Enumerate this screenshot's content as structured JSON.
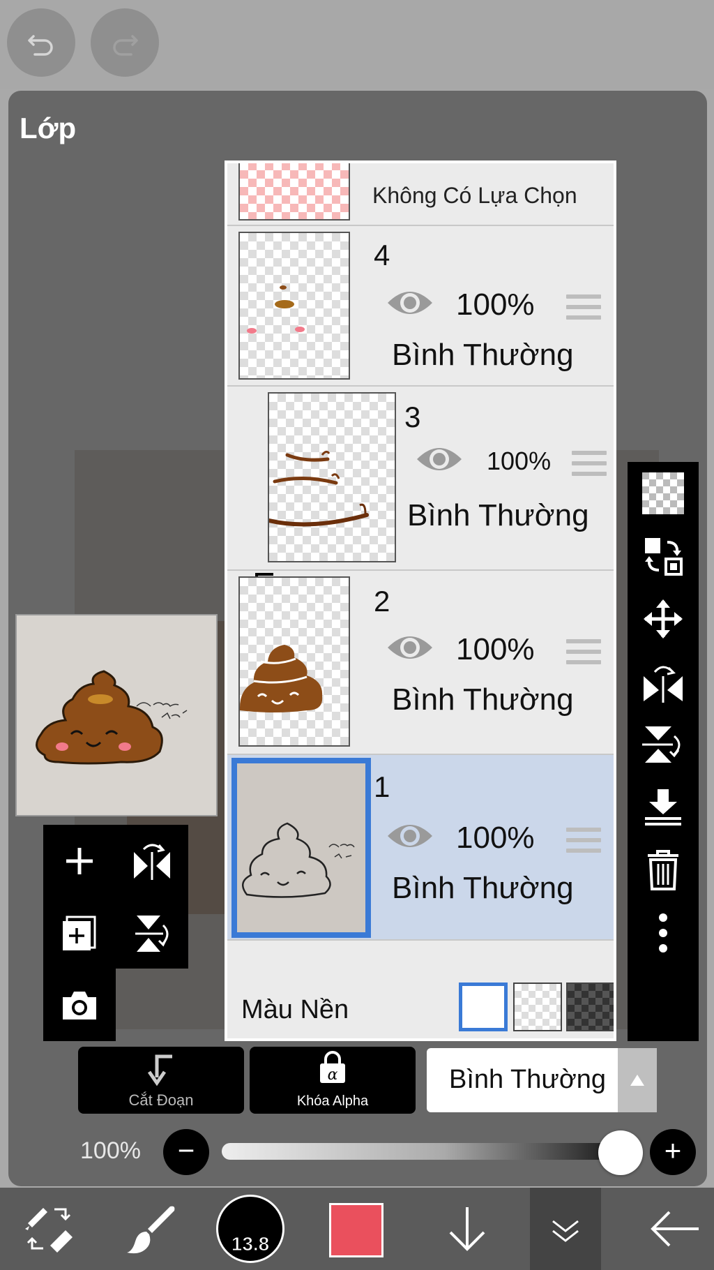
{
  "panel": {
    "title": "Lớp"
  },
  "layers": {
    "no_selection_label": "Không Có Lựa Chọn",
    "items": [
      {
        "number": "4",
        "opacity": "100%",
        "blend": "Bình Thường"
      },
      {
        "number": "3",
        "opacity": "100%",
        "blend": "Bình Thường"
      },
      {
        "number": "2",
        "opacity": "100%",
        "blend": "Bình Thường"
      },
      {
        "number": "1",
        "opacity": "100%",
        "blend": "Bình Thường"
      }
    ],
    "background": {
      "label": "Màu Nền"
    }
  },
  "bottom_controls": {
    "clip_label": "Cắt Đoạn",
    "alpha_lock_label": "Khóa Alpha",
    "blend_mode": "Bình Thường",
    "opacity_label": "100%",
    "opacity_value": 1.0
  },
  "toolbar": {
    "brush_size": "13.8",
    "color": "#ea505d"
  },
  "colors": {
    "selection": "#3a7ad6",
    "selected_row": "#cbd7ea"
  }
}
